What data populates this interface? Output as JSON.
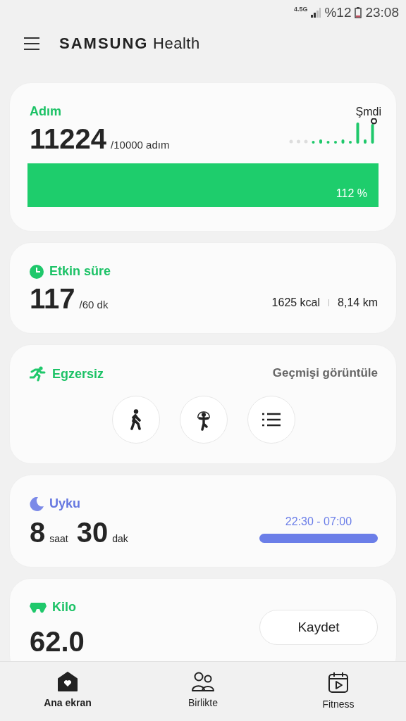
{
  "status_bar": {
    "network": "4.5G",
    "battery": "%12",
    "time": "23:08"
  },
  "header": {
    "title_brand": "SAMSUNG",
    "title_app": "Health"
  },
  "steps": {
    "title": "Adım",
    "value": "11224",
    "goal": "/10000 adım",
    "now_label": "Şmdi",
    "level": 1,
    "percent": "112 %"
  },
  "active_time": {
    "title": "Etkin süre",
    "value": "117",
    "goal": "/60 dk",
    "calories": "1625 kcal",
    "distance": "8,14 km"
  },
  "exercise": {
    "title": "Egzersiz",
    "history_link": "Geçmişi görüntüle",
    "shortcuts": [
      {
        "kind": "walk"
      },
      {
        "kind": "rope"
      },
      {
        "kind": "list"
      }
    ]
  },
  "sleep": {
    "title": "Uyku",
    "hours": "8",
    "hours_unit": "saat",
    "minutes": "30",
    "minutes_unit": "dak",
    "range": "22:30 - 07:00"
  },
  "weight": {
    "title": "Kilo",
    "value": "62.0",
    "button": "Kaydet"
  },
  "bottom_nav": [
    {
      "label": "Ana ekran",
      "kind": "home",
      "selected": true
    },
    {
      "label": "Birlikte",
      "kind": "together",
      "selected": false
    },
    {
      "label": "Fitness",
      "kind": "fitness",
      "selected": false
    }
  ]
}
